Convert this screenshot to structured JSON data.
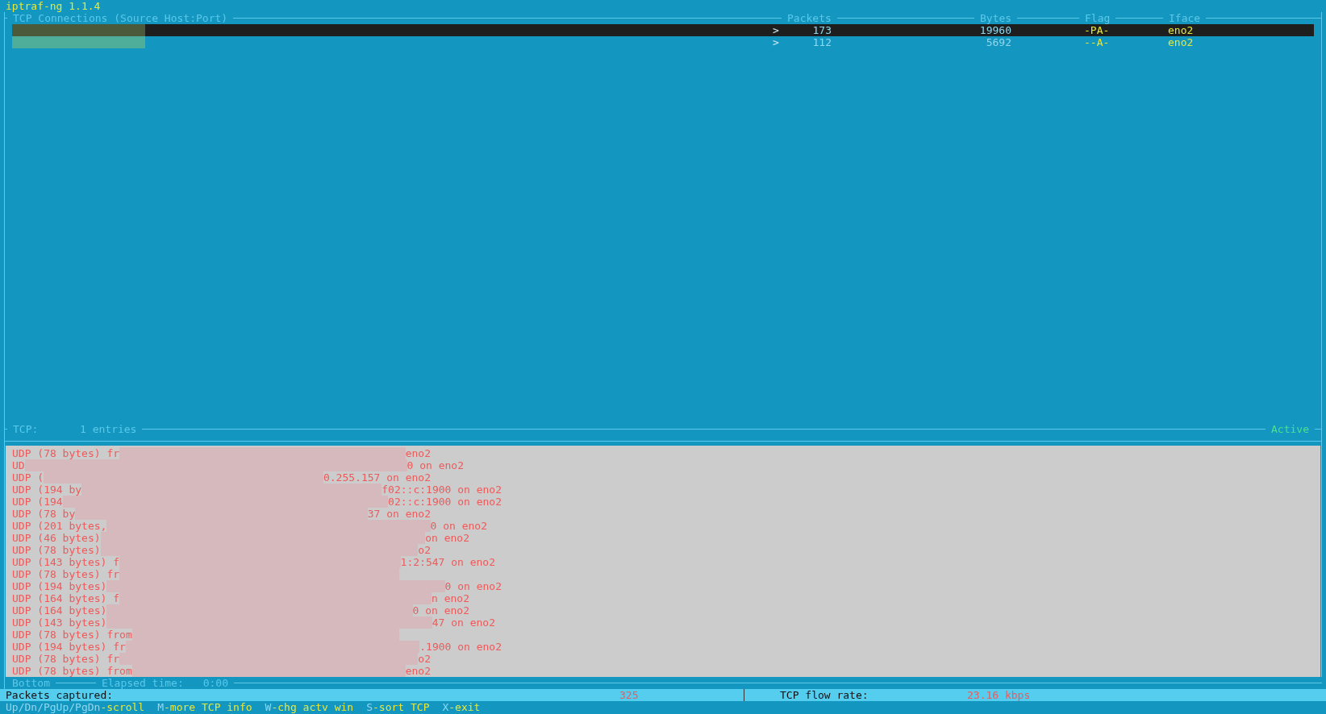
{
  "title": "iptraf-ng 1.1.4",
  "tcp_panel": {
    "title": "TCP Connections (Source Host:Port)",
    "columns": [
      "Packets",
      "Bytes",
      "Flag",
      "Iface"
    ],
    "rows": [
      {
        "direction": ">",
        "packets": "173",
        "bytes": "19960",
        "flag": "-PA-",
        "iface": "eno2",
        "selected": true
      },
      {
        "direction": ">",
        "packets": "112",
        "bytes": "5692",
        "flag": "--A-",
        "iface": "eno2",
        "selected": false
      }
    ],
    "footer_label": "TCP:",
    "entries": "1 entries",
    "status": "Active"
  },
  "udp_panel": {
    "lines": [
      {
        "start": "UDP (78 bytes) fr",
        "end": "eno2"
      },
      {
        "start": "UD",
        "end": "0 on eno2"
      },
      {
        "start": "UDP (",
        "end": "0.255.157 on eno2"
      },
      {
        "start": "UDP (194 by",
        "end": "f02::c:1900 on eno2"
      },
      {
        "start": "UDP (194",
        "end": "02::c:1900 on eno2"
      },
      {
        "start": "UDP (78 by",
        "end": "37 on eno2"
      },
      {
        "start": "UDP (201 bytes,",
        "end": "0 on eno2"
      },
      {
        "start": "UDP (46 bytes)",
        "end": "on eno2"
      },
      {
        "start": "UDP (78 bytes)",
        "end": "o2"
      },
      {
        "start": "UDP (143 bytes) f",
        "end": "1:2:547 on eno2"
      },
      {
        "start": "UDP (78 bytes) fr"
      },
      {
        "start": "UDP (194 bytes)",
        "end": "0 on eno2"
      },
      {
        "start": "UDP (164 bytes) f",
        "end": "n eno2"
      },
      {
        "start": "UDP (164 bytes)",
        "end": "0 on eno2"
      },
      {
        "start": "UDP (143 bytes)",
        "end": "47 on eno2"
      },
      {
        "start": "UDP (78 bytes) from"
      },
      {
        "start": "UDP (194 bytes) fr",
        "end": ".1900 on eno2"
      },
      {
        "start": "UDP (78 bytes) fr",
        "end": "o2"
      },
      {
        "start": "UDP (78 bytes) from",
        "end": "eno2"
      }
    ],
    "footer_label": "Bottom",
    "elapsed_label": "Elapsed time:",
    "elapsed": "0:00"
  },
  "status_bar": {
    "packets_label": "Packets captured:",
    "packets": "325",
    "flow_label": "TCP flow rate:",
    "flow": "23.16 kbps"
  },
  "hints": [
    {
      "key": "Up/Dn/PgUp/PgDn",
      "action": "-scroll"
    },
    {
      "key": "M",
      "action": "-more TCP info"
    },
    {
      "key": "W",
      "action": "-chg actv win"
    },
    {
      "key": "S",
      "action": "-sort TCP"
    },
    {
      "key": "X",
      "action": "-exit"
    }
  ]
}
